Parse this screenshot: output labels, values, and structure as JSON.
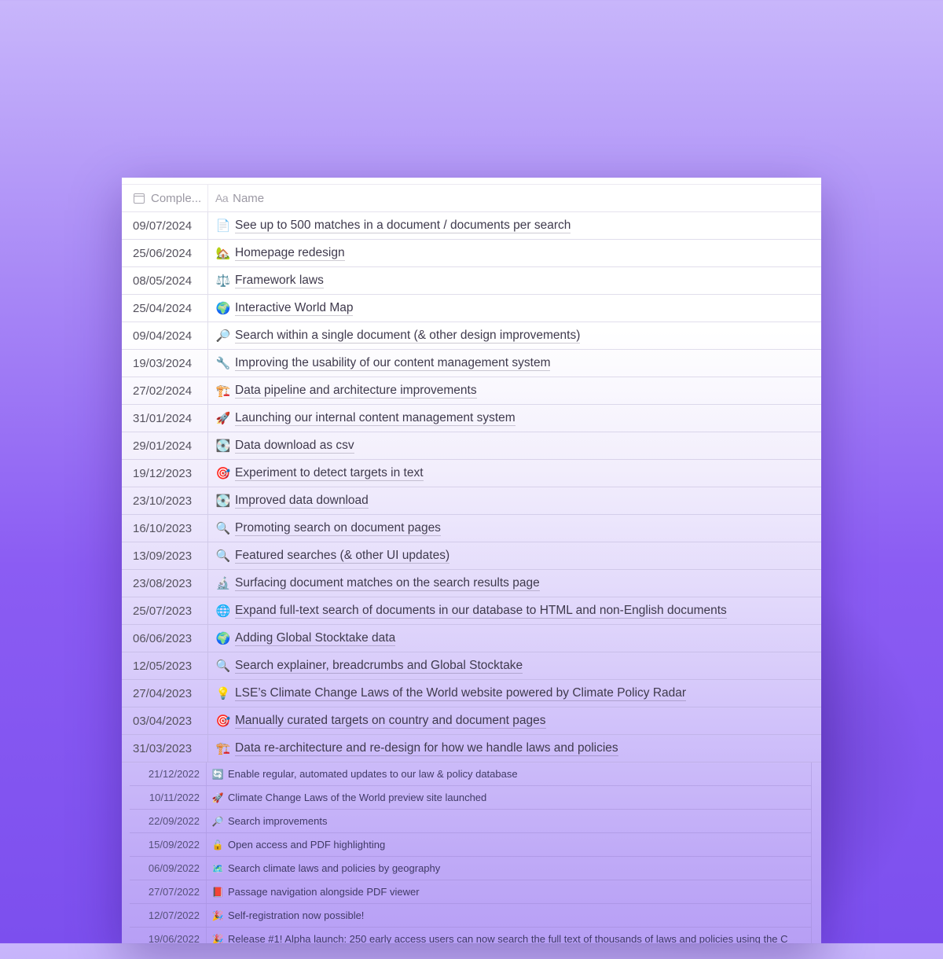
{
  "table": {
    "header": {
      "date_label": "Comple...",
      "name_prefix": "Aa",
      "name_label": "Name"
    },
    "rows": [
      {
        "date": "09/07/2024",
        "icon": "📄",
        "icon_name": "document-icon",
        "title": "See up to 500 matches in a document / documents per search"
      },
      {
        "date": "25/06/2024",
        "icon": "🏡",
        "icon_name": "house-icon",
        "title": "Homepage redesign"
      },
      {
        "date": "08/05/2024",
        "icon": "⚖️",
        "icon_name": "scales-icon",
        "title": "Framework laws"
      },
      {
        "date": "25/04/2024",
        "icon": "🌍",
        "icon_name": "globe-icon",
        "title": "Interactive World Map"
      },
      {
        "date": "09/04/2024",
        "icon": "🔎",
        "icon_name": "magnifier-icon",
        "title": "Search within a single document (& other design improvements)"
      },
      {
        "date": "19/03/2024",
        "icon": "🔧",
        "icon_name": "wrench-icon",
        "title": "Improving the usability of our content management system"
      },
      {
        "date": "27/02/2024",
        "icon": "🏗️",
        "icon_name": "construction-icon",
        "title": "Data pipeline and architecture improvements"
      },
      {
        "date": "31/01/2024",
        "icon": "🚀",
        "icon_name": "rocket-icon",
        "title": "Launching our internal content management system"
      },
      {
        "date": "29/01/2024",
        "icon": "💽",
        "icon_name": "disk-icon",
        "title": "Data download as csv"
      },
      {
        "date": "19/12/2023",
        "icon": "🎯",
        "icon_name": "target-icon",
        "title": "Experiment to detect targets in text"
      },
      {
        "date": "23/10/2023",
        "icon": "💽",
        "icon_name": "disk-icon",
        "title": "Improved data download"
      },
      {
        "date": "16/10/2023",
        "icon": "🔍",
        "icon_name": "magnifier-icon",
        "title": "Promoting search on document pages"
      },
      {
        "date": "13/09/2023",
        "icon": "🔍",
        "icon_name": "magnifier-icon",
        "title": "Featured searches (& other UI updates)"
      },
      {
        "date": "23/08/2023",
        "icon": "🔬",
        "icon_name": "microscope-icon",
        "title": "Surfacing document matches on the search results page"
      },
      {
        "date": "25/07/2023",
        "icon": "🌐",
        "icon_name": "globe-meridians-icon",
        "title": "Expand full-text search of documents in our database to HTML and non-English documents"
      },
      {
        "date": "06/06/2023",
        "icon": "🌍",
        "icon_name": "globe-icon",
        "title": "Adding Global Stocktake data"
      },
      {
        "date": "12/05/2023",
        "icon": "🔍",
        "icon_name": "magnifier-icon",
        "title": "Search explainer, breadcrumbs and Global Stocktake"
      },
      {
        "date": "27/04/2023",
        "icon": "💡",
        "icon_name": "lightbulb-icon",
        "title": "LSE’s Climate Change Laws of the World website powered by Climate Policy Radar"
      },
      {
        "date": "03/04/2023",
        "icon": "🎯",
        "icon_name": "target-icon",
        "title": "Manually curated targets on country and document pages"
      },
      {
        "date": "31/03/2023",
        "icon": "🏗️",
        "icon_name": "construction-icon",
        "title": "Data re-architecture and re-design for how we handle laws and policies"
      }
    ],
    "older_rows": [
      {
        "date": "21/12/2022",
        "icon": "🔄",
        "icon_name": "refresh-icon",
        "title": "Enable regular, automated updates to our law & policy database"
      },
      {
        "date": "10/11/2022",
        "icon": "🚀",
        "icon_name": "rocket-icon",
        "title": "Climate Change Laws of the World preview site launched"
      },
      {
        "date": "22/09/2022",
        "icon": "🔎",
        "icon_name": "magnifier-icon",
        "title": "Search improvements"
      },
      {
        "date": "15/09/2022",
        "icon": "🔓",
        "icon_name": "unlock-icon",
        "title": "Open access and PDF highlighting"
      },
      {
        "date": "06/09/2022",
        "icon": "🗺️",
        "icon_name": "map-icon",
        "title": "Search climate laws and policies by geography"
      },
      {
        "date": "27/07/2022",
        "icon": "📕",
        "icon_name": "book-icon",
        "title": "Passage navigation alongside PDF viewer"
      },
      {
        "date": "12/07/2022",
        "icon": "🎉",
        "icon_name": "party-popper-icon",
        "title": "Self-registration now possible!"
      },
      {
        "date": "19/06/2022",
        "icon": "🎉",
        "icon_name": "party-popper-icon",
        "title": "Release #1! Alpha launch: 250 early access users can now search the full text of thousands of laws and policies using the C"
      }
    ]
  }
}
